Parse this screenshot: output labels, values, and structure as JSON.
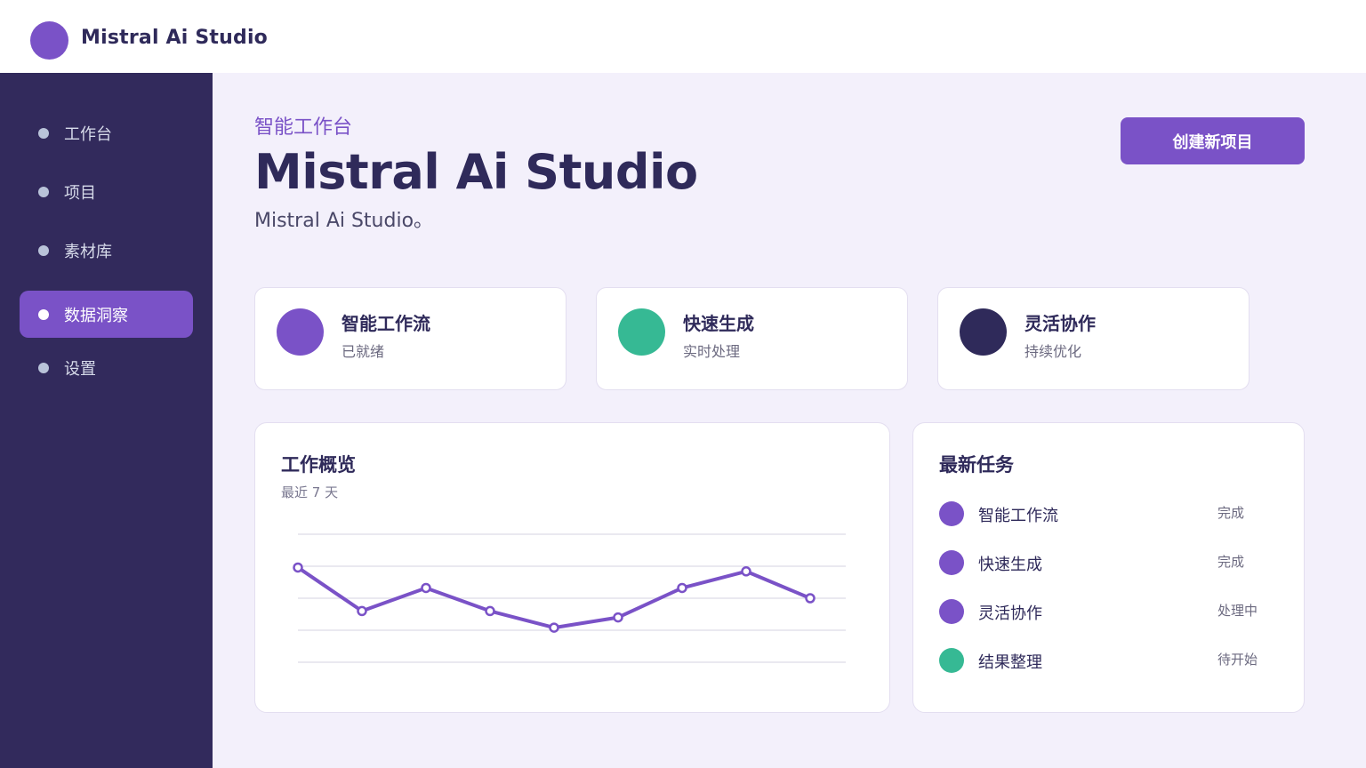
{
  "app": {
    "title": "Mistral Ai Studio"
  },
  "sidebar": {
    "items": [
      {
        "label": "工作台",
        "active": false
      },
      {
        "label": "项目",
        "active": false
      },
      {
        "label": "素材库",
        "active": false
      },
      {
        "label": "数据洞察",
        "active": true
      },
      {
        "label": "设置",
        "active": false
      }
    ]
  },
  "header": {
    "kicker": "智能工作台",
    "title": "Mistral Ai Studio",
    "subtitle": "Mistral Ai Studio。",
    "create_button": "创建新项目"
  },
  "features": [
    {
      "title": "智能工作流",
      "subtitle": "已就绪",
      "color": "#7a52c7"
    },
    {
      "title": "快速生成",
      "subtitle": "实时处理",
      "color": "#36b994"
    },
    {
      "title": "灵活协作",
      "subtitle": "持续优化",
      "color": "#2f2a5a"
    }
  ],
  "overview": {
    "title": "工作概览",
    "subtitle": "最近 7 天"
  },
  "tasks": {
    "title": "最新任务",
    "items": [
      {
        "name": "智能工作流",
        "status": "完成",
        "color": "#7a52c7"
      },
      {
        "name": "快速生成",
        "status": "完成",
        "color": "#7a52c7"
      },
      {
        "name": "灵活协作",
        "status": "处理中",
        "color": "#7a52c7"
      },
      {
        "name": "结果整理",
        "status": "待开始",
        "color": "#36b994"
      }
    ]
  },
  "colors": {
    "accent": "#7a52c7",
    "teal": "#36b994",
    "navy": "#322a5c",
    "background": "#f3f0fb"
  },
  "chart_data": {
    "type": "line",
    "title": "",
    "xlabel": "",
    "ylabel": "",
    "grid": true,
    "ylim": [
      0,
      100
    ],
    "x": [
      1,
      2,
      3,
      4,
      5,
      6,
      7,
      8,
      9
    ],
    "series": [
      {
        "values": [
          74,
          40,
          58,
          40,
          27,
          35,
          58,
          71,
          50
        ],
        "color": "#7a52c7"
      }
    ]
  }
}
